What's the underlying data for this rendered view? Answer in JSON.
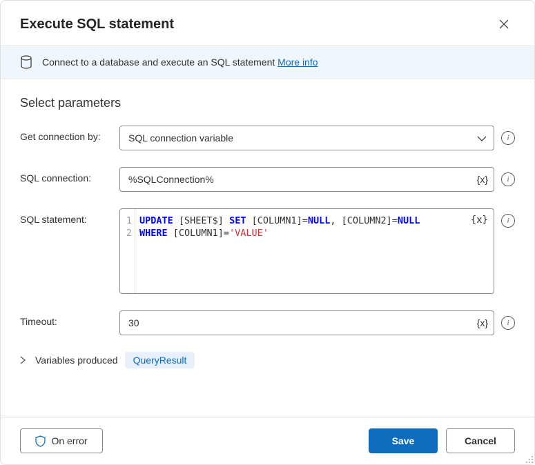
{
  "header": {
    "title": "Execute SQL statement"
  },
  "banner": {
    "text": "Connect to a database and execute an SQL statement ",
    "link": "More info"
  },
  "section": {
    "title": "Select parameters"
  },
  "fields": {
    "get_connection_by": {
      "label": "Get connection by:",
      "value": "SQL connection variable"
    },
    "sql_connection": {
      "label": "SQL connection:",
      "value": "%SQLConnection%",
      "var_token": "{x}"
    },
    "sql_statement": {
      "label": "SQL statement:",
      "var_token": "{x}",
      "lines": [
        "1",
        "2"
      ],
      "tokens": [
        [
          {
            "t": "UPDATE",
            "c": "kw"
          },
          {
            "t": " [SHEET$] ",
            "c": ""
          },
          {
            "t": "SET",
            "c": "kw"
          },
          {
            "t": " [COLUMN1]=",
            "c": ""
          },
          {
            "t": "NULL",
            "c": "kw"
          },
          {
            "t": ", [COLUMN2]=",
            "c": ""
          },
          {
            "t": "NULL",
            "c": "kw"
          }
        ],
        [
          {
            "t": "WHERE",
            "c": "kw"
          },
          {
            "t": " [COLUMN1]=",
            "c": ""
          },
          {
            "t": "'VALUE'",
            "c": "str"
          }
        ]
      ]
    },
    "timeout": {
      "label": "Timeout:",
      "value": "30",
      "var_token": "{x}"
    }
  },
  "variables": {
    "label": "Variables produced",
    "chip": "QueryResult"
  },
  "footer": {
    "on_error": "On error",
    "save": "Save",
    "cancel": "Cancel"
  }
}
